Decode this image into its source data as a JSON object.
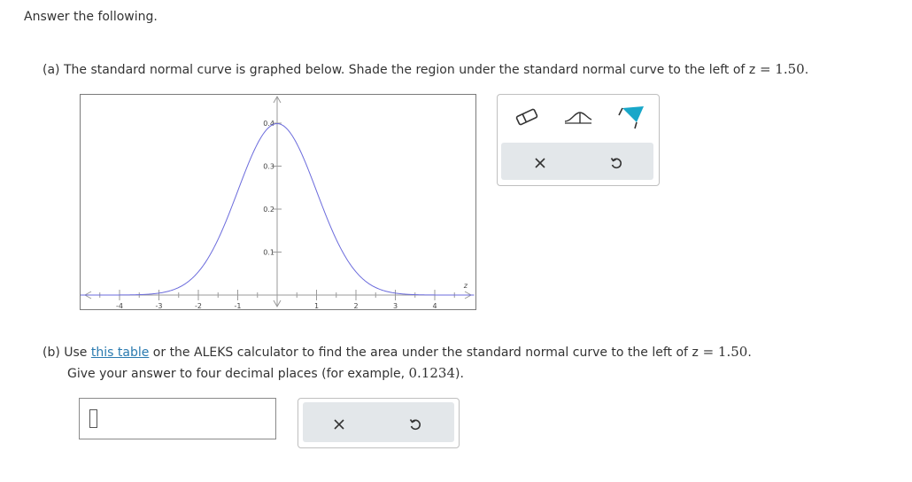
{
  "header": {
    "instruction": "Answer the following."
  },
  "part_a": {
    "prefix": "(a) The standard normal curve is graphed below. Shade the region under the standard normal curve to the left of ",
    "z_var": "z",
    "eq": " = ",
    "z_value": "1.50",
    "period": "."
  },
  "graph": {
    "x_ticks": [
      "-4",
      "-3",
      "-2",
      "-1",
      "1",
      "2",
      "3",
      "4"
    ],
    "y_ticks": [
      "0.4",
      "0.3",
      "0.2",
      "0.1"
    ],
    "x_axis_label": "z",
    "curve_color": "#6b6bdc"
  },
  "tools": {
    "eraser": "eraser-icon",
    "left_tail": "left-tail-shade-icon",
    "shade": "shade-region-icon",
    "clear": "close-icon",
    "undo": "undo-icon",
    "accent": "#18a7c9"
  },
  "part_b": {
    "prefix": "(b) Use ",
    "link": "this table",
    "middle": " or the ALEKS calculator to find the area under the standard normal curve to the left of ",
    "z_var": "z",
    "eq": " = ",
    "z_value": "1.50",
    "period": ".",
    "line2": "Give your answer to four decimal places (for example, ",
    "example": "0.1234",
    "line2_end": ")."
  },
  "answer": {
    "value": ""
  }
}
